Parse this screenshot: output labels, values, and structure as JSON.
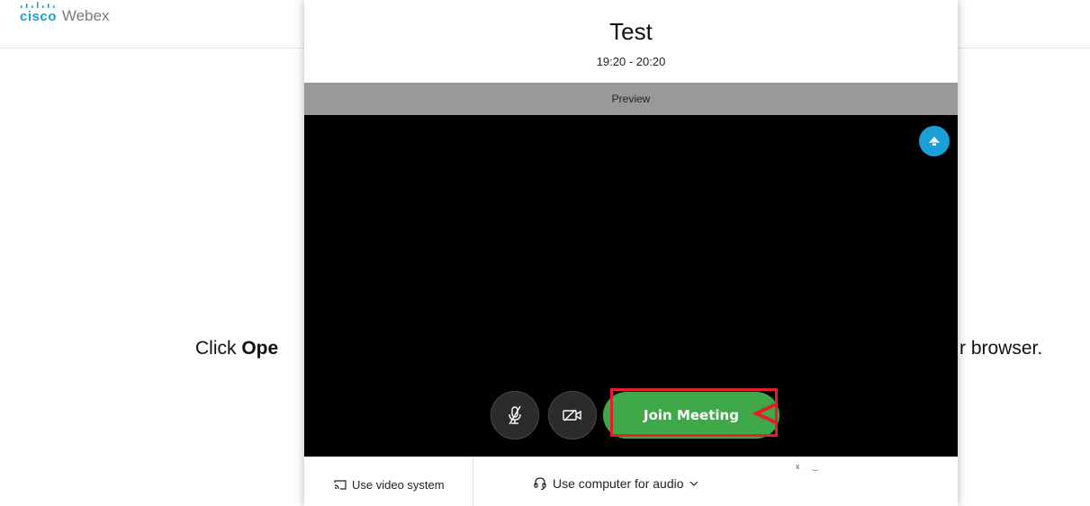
{
  "header": {
    "brand": "cisco",
    "product": "Webex"
  },
  "background": {
    "message_left_prefix": "Click ",
    "message_left_bold": "Ope",
    "message_right": "r browser."
  },
  "modal": {
    "title": "Test",
    "time": "19:20 - 20:20",
    "preview_label": "Preview",
    "join_label": "Join Meeting",
    "video_system_label": "Use video system",
    "audio_label": "Use computer for audio",
    "bottom_marks": "x ͜"
  },
  "colors": {
    "brand": "#1ba0d7",
    "join": "#3fa849",
    "highlight": "#e41e2b",
    "preview_bar": "#999999",
    "status": "#1a9fd8"
  },
  "icons": {
    "mic": "mic-muted-icon",
    "camera": "camera-off-icon",
    "status": "network-status-icon",
    "video_system": "cast-icon",
    "audio": "headset-icon",
    "dropdown": "chevron-down-icon"
  }
}
